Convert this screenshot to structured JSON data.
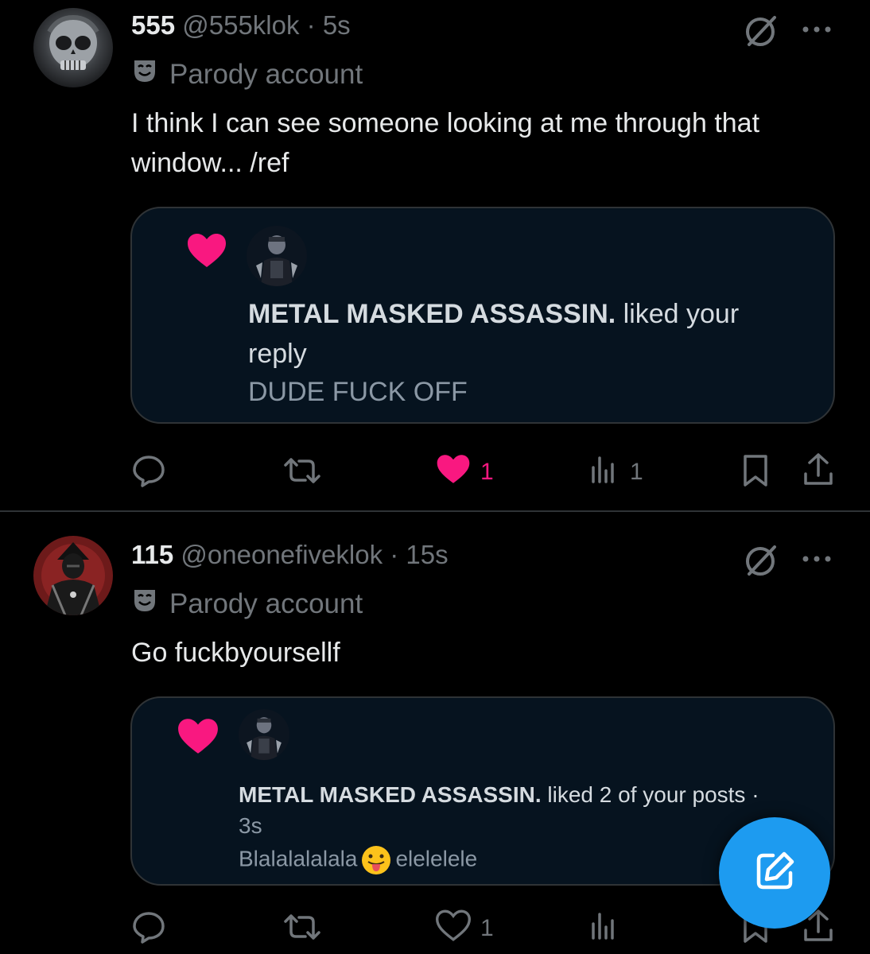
{
  "posts": [
    {
      "display_name": "555",
      "handle": "@555klok",
      "separator": "·",
      "time": "5s",
      "parody_label": "Parody account",
      "text": "I think I can see someone looking at me through that window... /ref",
      "card": {
        "notif_name": "METAL MASKED ASSASSIN.",
        "notif_action": "liked your reply",
        "excerpt": "DUDE FUCK OFF",
        "heart_color": "#f91880"
      },
      "actions": {
        "reply_count": "",
        "repost_count": "",
        "like_count": "1",
        "liked": true,
        "views_count": "1"
      }
    },
    {
      "display_name": "115",
      "handle": "@oneonefiveklok",
      "separator": "·",
      "time": "15s",
      "parody_label": "Parody account",
      "text": "Go fuckbyoursellf",
      "card": {
        "notif_name": "METAL MASKED ASSASSIN.",
        "notif_action": "liked 2 of your posts ·",
        "notif_time": "3s",
        "excerpt_before": "Blalalalalala",
        "excerpt_emoji": "face-with-tongue-emoji",
        "excerpt_after": "elelelele",
        "heart_color": "#f91880"
      },
      "actions": {
        "reply_count": "",
        "repost_count": "",
        "like_count": "1",
        "liked": false,
        "views_count": ""
      }
    }
  ],
  "colors": {
    "background": "#000000",
    "secondary_text": "#71767b",
    "like_pink": "#f91880",
    "accent_blue": "#1d9bf0",
    "card_bg": "#06131f",
    "divider": "#2f3336"
  },
  "icons": {
    "grok": "grok-icon",
    "more": "more-options-icon",
    "reply": "reply-icon",
    "repost": "repost-icon",
    "like": "heart-icon",
    "views": "views-icon",
    "bookmark": "bookmark-icon",
    "share": "share-icon",
    "compose": "compose-icon",
    "parody": "parody-mask-icon"
  }
}
